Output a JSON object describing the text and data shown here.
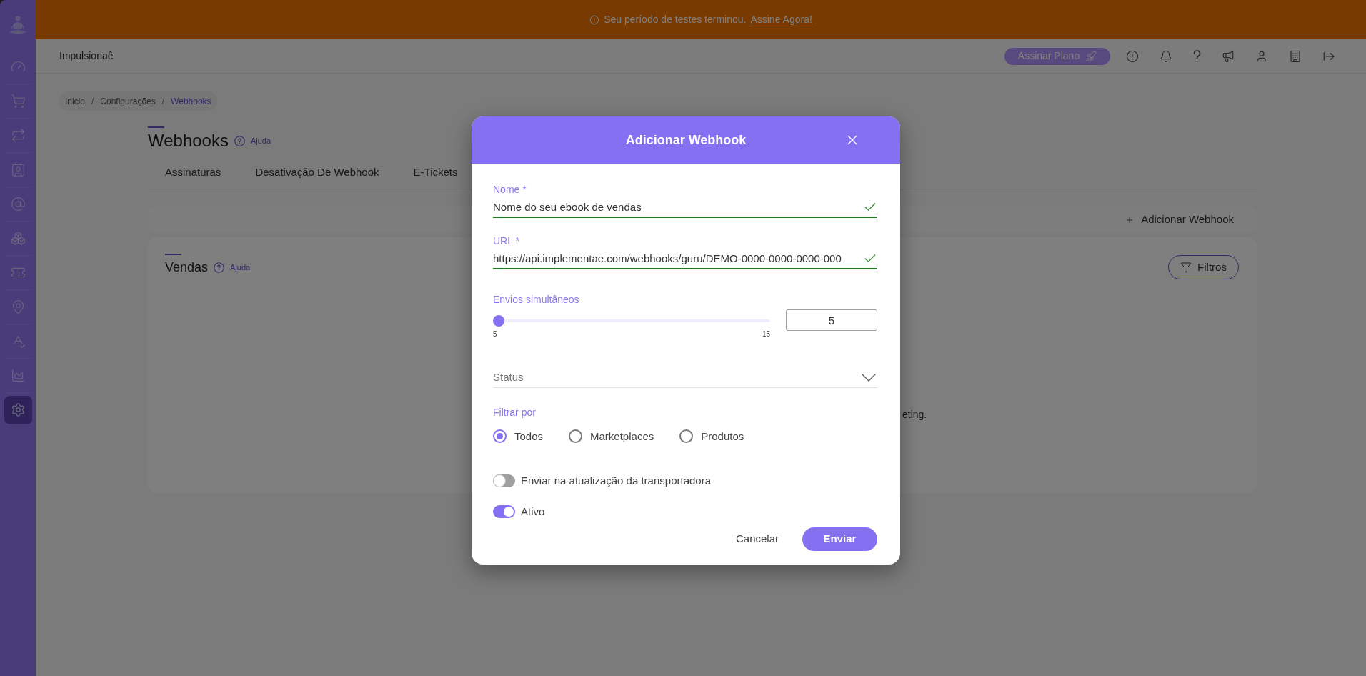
{
  "sidebar": {
    "items": [
      {
        "selected": false
      },
      {
        "selected": false
      },
      {
        "selected": false
      },
      {
        "selected": false
      },
      {
        "selected": false
      },
      {
        "selected": false
      },
      {
        "selected": false
      },
      {
        "selected": false
      },
      {
        "selected": false
      },
      {
        "selected": false
      },
      {
        "selected": true
      }
    ]
  },
  "banner": {
    "message": "Seu período de testes terminou.",
    "link": "Assine Agora!"
  },
  "header": {
    "app_name": "Impulsionaê",
    "plan_button": "Assinar Plano"
  },
  "breadcrumb": {
    "separator": "/",
    "items": [
      {
        "label": "Inicio",
        "current": false
      },
      {
        "label": "Configurações",
        "current": false
      },
      {
        "label": "Webhooks",
        "current": true
      }
    ]
  },
  "page": {
    "title": "Webhooks",
    "help": "Ajuda",
    "tabs": [
      {
        "label": "Assinaturas",
        "selected": false
      },
      {
        "label": "Desativação De Webhook",
        "selected": false
      },
      {
        "label": "E-Tickets",
        "selected": false
      }
    ]
  },
  "toolbar": {
    "add_button": "Adicionar Webhook"
  },
  "section": {
    "title": "Vendas",
    "help": "Ajuda",
    "filter_button": "Filtros",
    "empty_text": "eting."
  },
  "dialog": {
    "title": "Adicionar Webhook",
    "fields": [
      {
        "label": "Nome *",
        "value": "Nome do seu ebook de vendas",
        "valid": true
      },
      {
        "label": "URL *",
        "value": "https://api.implementae.com/webhooks/guru/DEMO-0000-0000-0000-000",
        "valid": true
      }
    ],
    "concurrency": {
      "label": "Envios simultâneos",
      "level": 0,
      "min": "5",
      "max": "15",
      "value": "5"
    },
    "status": {
      "placeholder": "Status"
    },
    "filter": {
      "label": "Filtrar por",
      "options": [
        {
          "label": "Todos",
          "selected": true
        },
        {
          "label": "Marketplaces",
          "selected": false
        },
        {
          "label": "Produtos",
          "selected": false
        }
      ]
    },
    "toggles": [
      {
        "label": "Enviar na atualização da transportadora",
        "on": false
      },
      {
        "label": "Ativo",
        "on": true
      }
    ],
    "buttons": [
      {
        "label": "Cancelar",
        "kind": "text"
      },
      {
        "label": "Enviar",
        "kind": "primary"
      }
    ]
  }
}
